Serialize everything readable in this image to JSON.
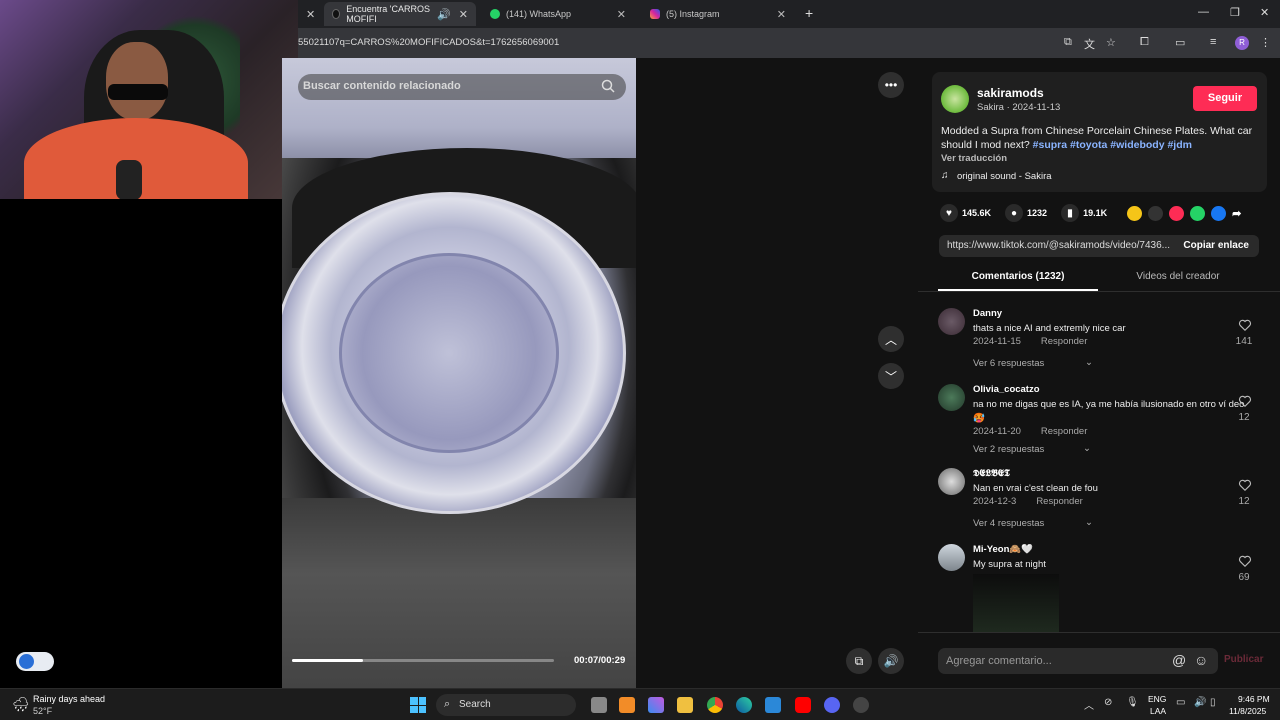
{
  "browser": {
    "tabs": [
      {
        "title": "Encuentra 'CARROS MOFIFI"
      },
      {
        "title": "(141) WhatsApp"
      },
      {
        "title": "(5) Instagram"
      }
    ],
    "new_tab": "+",
    "url": "55021107q=CARROS%20MOFIFICADOS&t=1762656069001"
  },
  "video": {
    "search_placeholder": "Buscar contenido relacionado",
    "time": "00:07/00:29",
    "progress": 0.27
  },
  "post": {
    "username": "sakiramods",
    "subtitle": "Sakira · 2024-11-13",
    "follow_label": "Seguir",
    "caption": "Modded a Supra from Chinese Porcelain Chinese Plates. What car should I mod next?",
    "hashtags": [
      "#supra",
      "#toyota",
      "#widebody",
      "#jdm"
    ],
    "translate_label": "Ver traducción",
    "sound": "original sound - Sakira",
    "likes": "145.6K",
    "comments_count": "1232",
    "saves": "19.1K",
    "link": "https://www.tiktok.com/@sakiramods/video/7436...",
    "copy_link_label": "Copiar enlace",
    "tab_comments": "Comentarios (1232)",
    "tab_creator": "Videos del creador"
  },
  "comments": [
    {
      "name": "Danny",
      "text": "thats a nice AI and extremly nice car",
      "date": "2024-11-15",
      "reply": "Responder",
      "more": "Ver 6 respuestas",
      "likes": "141"
    },
    {
      "name": "Olivia_cocatzo",
      "text": "na no me digas que es IA, ya me había ilusionado en otro ví deo 🥵",
      "date": "2024-11-20",
      "reply": "Responder",
      "more": "Ver 2 respuestas",
      "likes": "12"
    },
    {
      "name": "𝕯𝕰𝕷𝕭𝕰𝕿",
      "text": "Nan en vrai c'est clean de fou",
      "date": "2024-12-3",
      "reply": "Responder",
      "more": "Ver 4 respuestas",
      "likes": "12"
    },
    {
      "name": "Mi-Yeon🙈🤍",
      "text": "My supra at night",
      "likes": "69"
    }
  ],
  "add_comment_placeholder": "Agregar comentario...",
  "publish_label": "Publicar",
  "taskbar": {
    "weather_title": "Rainy days ahead",
    "weather_temp": "52°F",
    "search_label": "Search",
    "lang_top": "ENG",
    "lang_bottom": "LAA",
    "time": "9:46 PM",
    "date": "11/8/2025"
  },
  "colors": {
    "follow": "#fe2c55",
    "hashtag": "#8ab4ff",
    "publish": "#6b2a38"
  }
}
